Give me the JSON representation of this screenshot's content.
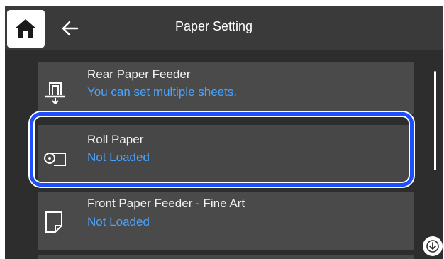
{
  "header": {
    "title": "Paper Setting",
    "home_icon": "home-icon",
    "back_icon": "back-arrow-icon"
  },
  "paper_sources": [
    {
      "name": "Rear Paper Feeder",
      "status": "You can set multiple sheets.",
      "icon": "rear-feeder-icon"
    },
    {
      "name": "Roll Paper",
      "status": "Not Loaded",
      "icon": "roll-paper-icon",
      "selected": true
    },
    {
      "name": "Front Paper Feeder - Fine Art",
      "status": "Not Loaded",
      "icon": "sheet-paper-icon"
    }
  ],
  "scroll": {
    "down_icon": "scroll-down-icon"
  },
  "colors": {
    "background": "#2d2d2d",
    "item": "#4a4a4a",
    "status_text": "#4aa3ff",
    "highlight": "#1e4fff"
  }
}
